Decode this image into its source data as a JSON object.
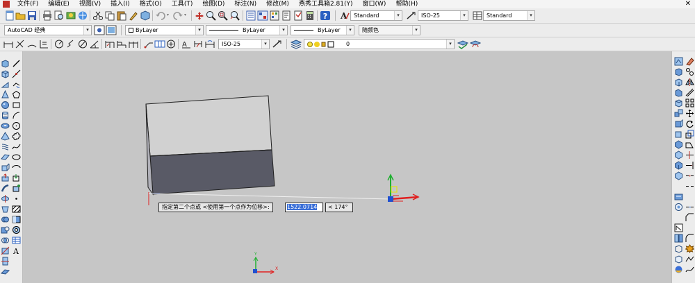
{
  "menu": [
    "文件(F)",
    "编辑(E)",
    "视图(V)",
    "插入(I)",
    "格式(O)",
    "工具(T)",
    "绘图(D)",
    "标注(N)",
    "修改(M)",
    "燕秀工具箱2.81(Y)",
    "窗口(W)",
    "帮助(H)"
  ],
  "window_close": "✕",
  "toolbar1": {
    "text_style": "Standard",
    "dim_style": "ISO-25",
    "table_style": "Standard"
  },
  "toolbar2": {
    "workspace": "AutoCAD 经典",
    "color": "ByLayer",
    "linetype": "ByLayer",
    "lineweight": "ByLayer",
    "plot_style": "随颜色"
  },
  "toolbar3": {
    "dim_style": "ISO-25",
    "layer": "0"
  },
  "command": {
    "prompt": "指定第二个点或 <使用第一个点作为位移>:",
    "input_value": "1522.0714",
    "angle": "< 174°"
  },
  "ucs": {
    "x": "X",
    "y": "Y"
  },
  "colors": {
    "box_top": "#d1d1d1",
    "box_front": "#595a66",
    "axis_x": "#e02020",
    "axis_y": "#20b030",
    "axis_z": "#2050d0",
    "highlight": "#3a6fd8"
  }
}
